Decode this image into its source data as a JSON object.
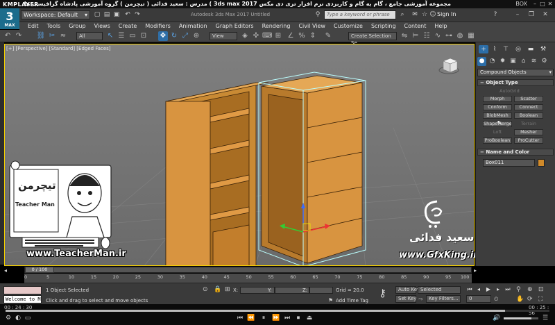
{
  "player": {
    "logo": "KMPLAYER",
    "course_title": "مجموعه آموزشی جامع ، گام به گام و کاربردی نرم افزار تری دی مکس 3ds max 2017 ) مدرس : سعید فدائی ( تیچرمن ) گروه آموزشی پادشاه گرافیست ها",
    "window_label": "BOX",
    "time_elapsed": "00 : 24 : 30",
    "time_total": "00 : 25 : 56"
  },
  "titlebar": {
    "logo_text": "3",
    "logo_sub": "MAX",
    "workspace": "Workspace: Default",
    "app_title": "Autodesk 3ds Max 2017    Untitled",
    "search_placeholder": "Type a keyword or phrase",
    "sign_in": "Sign In"
  },
  "menu": [
    "Edit",
    "Tools",
    "Group",
    "Views",
    "Create",
    "Modifiers",
    "Animation",
    "Graph Editors",
    "Rendering",
    "Civil View",
    "Customize",
    "Scripting",
    "Content",
    "Help"
  ],
  "toolbar": {
    "filter": "All",
    "ref_coord": "View",
    "selection_set": "Create Selection Se"
  },
  "viewport": {
    "label": "[+] [Perspective] [Standard] [Edged Faces]"
  },
  "command_panel": {
    "category": "Compound Objects",
    "object_type_title": "Object Type",
    "autogrid": "AutoGrid",
    "buttons": [
      [
        "Morph",
        "Scatter"
      ],
      [
        "Conform",
        "Connect"
      ],
      [
        "BlobMesh",
        "Boolean"
      ],
      [
        "ShapeMerge",
        "Terrain"
      ],
      [
        "Loft",
        "Mesher"
      ],
      [
        "ProBoolean",
        "ProCutter"
      ]
    ],
    "name_color_title": "Name and Color",
    "object_name": "Box011",
    "object_color": "#d08a2a"
  },
  "timeline": {
    "frame": "0 / 100",
    "ticks": [
      "0",
      "5",
      "10",
      "15",
      "20",
      "25",
      "30",
      "35",
      "40",
      "45",
      "50",
      "55",
      "60",
      "65",
      "70",
      "75",
      "80",
      "85",
      "90",
      "95",
      "100"
    ]
  },
  "status": {
    "maxscript_text": "Welcome to M",
    "selected": "1 Object Selected",
    "prompt": "Click and drag to select and move objects",
    "x_label": "X:",
    "y_label": "Y:",
    "z_label": "Z:",
    "grid": "Grid = 20.0",
    "add_time_tag": "Add Time Tag",
    "auto_key": "Auto Key",
    "set_key": "Set Key",
    "selected_dropdown": "Selected",
    "key_filters": "Key Filters...",
    "frame_field": "0"
  },
  "watermarks": {
    "teacher_brand": "تیچرمن",
    "teacher_name": "Teacher Man",
    "teacher_url": "www.TeacherMan.ir",
    "gfx_name": "سعید فدائی",
    "gfx_url": "www.GfxKing.ir"
  }
}
